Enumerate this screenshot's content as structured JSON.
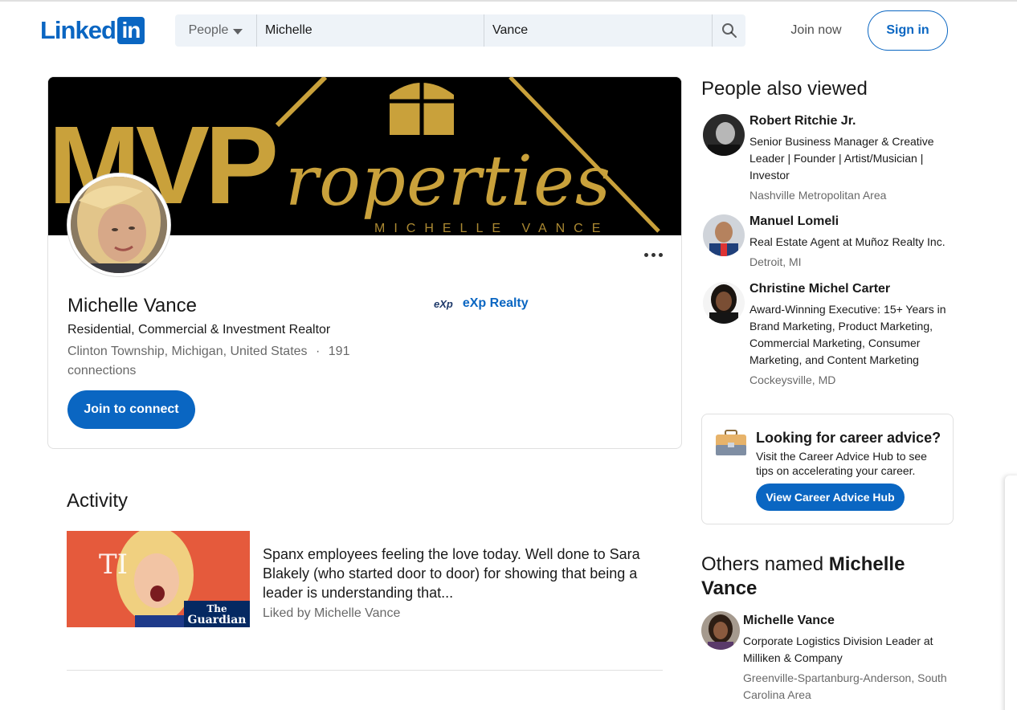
{
  "header": {
    "logo_text": "Linked",
    "logo_box_text": "in",
    "search_type": "People",
    "first_name_value": "Michelle",
    "last_name_value": "Vance",
    "join_now": "Join now",
    "sign_in": "Sign in"
  },
  "profile": {
    "banner_text_mv": "MVP",
    "banner_text_roperties": "roperties",
    "banner_subtext": "MICHELLE VANCE",
    "name": "Michelle Vance",
    "headline": "Residential, Commercial & Investment Realtor",
    "location": "Clinton Township, Michigan, United States",
    "separator": "·",
    "connections": "191 connections",
    "company_logo_text": "eXp",
    "company": "eXp Realty",
    "join_button": "Join to connect"
  },
  "activity": {
    "title": "Activity",
    "post_text": "Spanx employees feeling the love today. Well done to Sara Blakely (who started door to door) for showing that being a leader is understanding that...",
    "liked_by": "Liked by Michelle Vance",
    "image_badge_line1": "The",
    "image_badge_line2": "Guardian",
    "image_bg_text": "TI"
  },
  "people_also_viewed": {
    "title": "People also viewed",
    "people": [
      {
        "name": "Robert Ritchie Jr.",
        "description": "Senior Business Manager & Creative Leader | Founder | Artist/Musician | Investor",
        "location": "Nashville Metropolitan Area"
      },
      {
        "name": "Manuel Lomeli",
        "description": "Real Estate Agent at Muñoz Realty Inc.",
        "location": "Detroit, MI"
      },
      {
        "name": "Christine Michel Carter",
        "description": "Award-Winning Executive: 15+ Years in Brand Marketing, Product Marketing, Commercial Marketing, Consumer Marketing, and Content Marketing",
        "location": "Cockeysville, MD"
      }
    ]
  },
  "career": {
    "title": "Looking for career advice?",
    "description": "Visit the Career Advice Hub to see tips on accelerating your career.",
    "button": "View Career Advice Hub"
  },
  "others_named": {
    "title_prefix": "Others named",
    "title_name": "Michelle Vance",
    "person": {
      "name": "Michelle Vance",
      "description": "Corporate Logistics Division Leader at Milliken & Company",
      "location": "Greenville-Spartanburg-Anderson, South Carolina Area"
    }
  },
  "colors": {
    "brand_blue": "#0a66c2",
    "banner_gold": "#c9a13b",
    "banner_black": "#000000"
  }
}
